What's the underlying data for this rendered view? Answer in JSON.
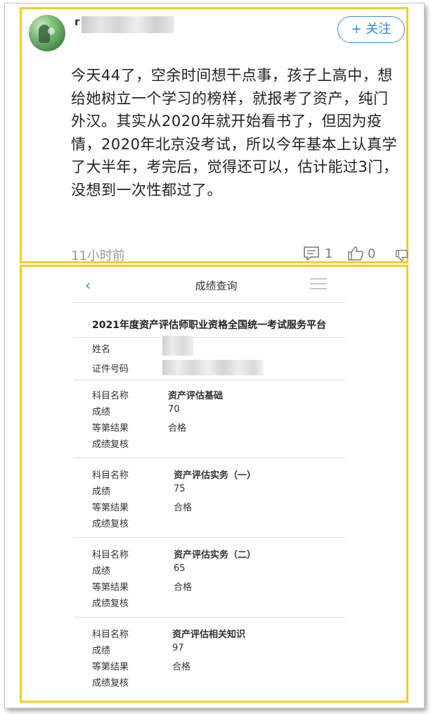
{
  "post": {
    "username_initial": "r",
    "follow_label": "+ 关注",
    "text": "今天44了，空余时间想干点事，孩子上高中，想给她树立一个学习的榜样，就报考了资产，纯门外汉。其实从2020年就开始看书了，但因为疫情，2020年北京没考试，所以今年基本上认真学了大半年，考完后，觉得还可以，估计能过3门，没想到一次性都过了。",
    "time": "11小时前",
    "comment_count": "1",
    "like_count": "0"
  },
  "result_page": {
    "back_glyph": "‹",
    "nav_title": "成绩查询",
    "platform_title": "2021年度资产评估师职业资格全国统一考试服务平台",
    "name_label": "姓名",
    "id_label": "证件号码",
    "labels": {
      "subject": "科目名称",
      "score": "成绩",
      "grade": "等第结果",
      "review": "成绩复核"
    },
    "subjects": [
      {
        "name": "资产评估基础",
        "score": "70",
        "grade": "合格"
      },
      {
        "name": "资产评估实务（一）",
        "score": "75",
        "grade": "合格"
      },
      {
        "name": "资产评估实务（二）",
        "score": "65",
        "grade": "合格"
      },
      {
        "name": "资产评估相关知识",
        "score": "97",
        "grade": "合格"
      }
    ]
  },
  "colors": {
    "frame_border": "#f2cf1f",
    "accent_blue": "#2f86e6",
    "muted_text": "#9a9a9a"
  }
}
